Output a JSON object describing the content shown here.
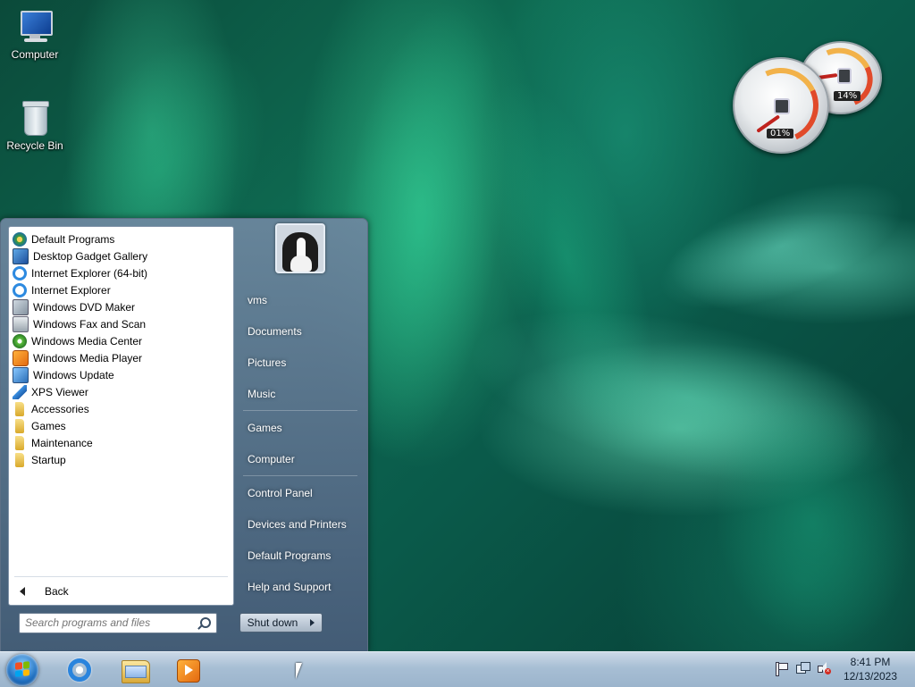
{
  "desktop": {
    "icons": [
      {
        "label": "Computer"
      },
      {
        "label": "Recycle Bin"
      }
    ]
  },
  "gadget": {
    "cpu_percent": "01%",
    "memory_percent": "14%"
  },
  "start_menu": {
    "programs": [
      {
        "label": "Default Programs",
        "icon": "default-programs-icon"
      },
      {
        "label": "Desktop Gadget Gallery",
        "icon": "gadget-gallery-icon"
      },
      {
        "label": "Internet Explorer (64-bit)",
        "icon": "internet-explorer-icon"
      },
      {
        "label": "Internet Explorer",
        "icon": "internet-explorer-icon"
      },
      {
        "label": "Windows DVD Maker",
        "icon": "dvd-maker-icon"
      },
      {
        "label": "Windows Fax and Scan",
        "icon": "fax-scan-icon"
      },
      {
        "label": "Windows Media Center",
        "icon": "media-center-icon"
      },
      {
        "label": "Windows Media Player",
        "icon": "media-player-icon"
      },
      {
        "label": "Windows Update",
        "icon": "windows-update-icon"
      },
      {
        "label": "XPS Viewer",
        "icon": "xps-viewer-icon"
      },
      {
        "label": "Accessories",
        "icon": "folder-icon"
      },
      {
        "label": "Games",
        "icon": "folder-icon"
      },
      {
        "label": "Maintenance",
        "icon": "folder-icon"
      },
      {
        "label": "Startup",
        "icon": "folder-icon"
      }
    ],
    "back_label": "Back",
    "search_placeholder": "Search programs and files",
    "right_links": {
      "user": "vms",
      "documents": "Documents",
      "pictures": "Pictures",
      "music": "Music",
      "games": "Games",
      "computer": "Computer",
      "control_panel": "Control Panel",
      "devices_printers": "Devices and Printers",
      "default_programs": "Default Programs",
      "help_support": "Help and Support"
    },
    "shutdown_label": "Shut down"
  },
  "taskbar": {
    "clock_time": "8:41 PM",
    "clock_date": "12/13/2023"
  },
  "colors": {
    "taskbar": "#a7bed4",
    "start_menu": "#5e7893",
    "desktop": "#0e6b52"
  }
}
